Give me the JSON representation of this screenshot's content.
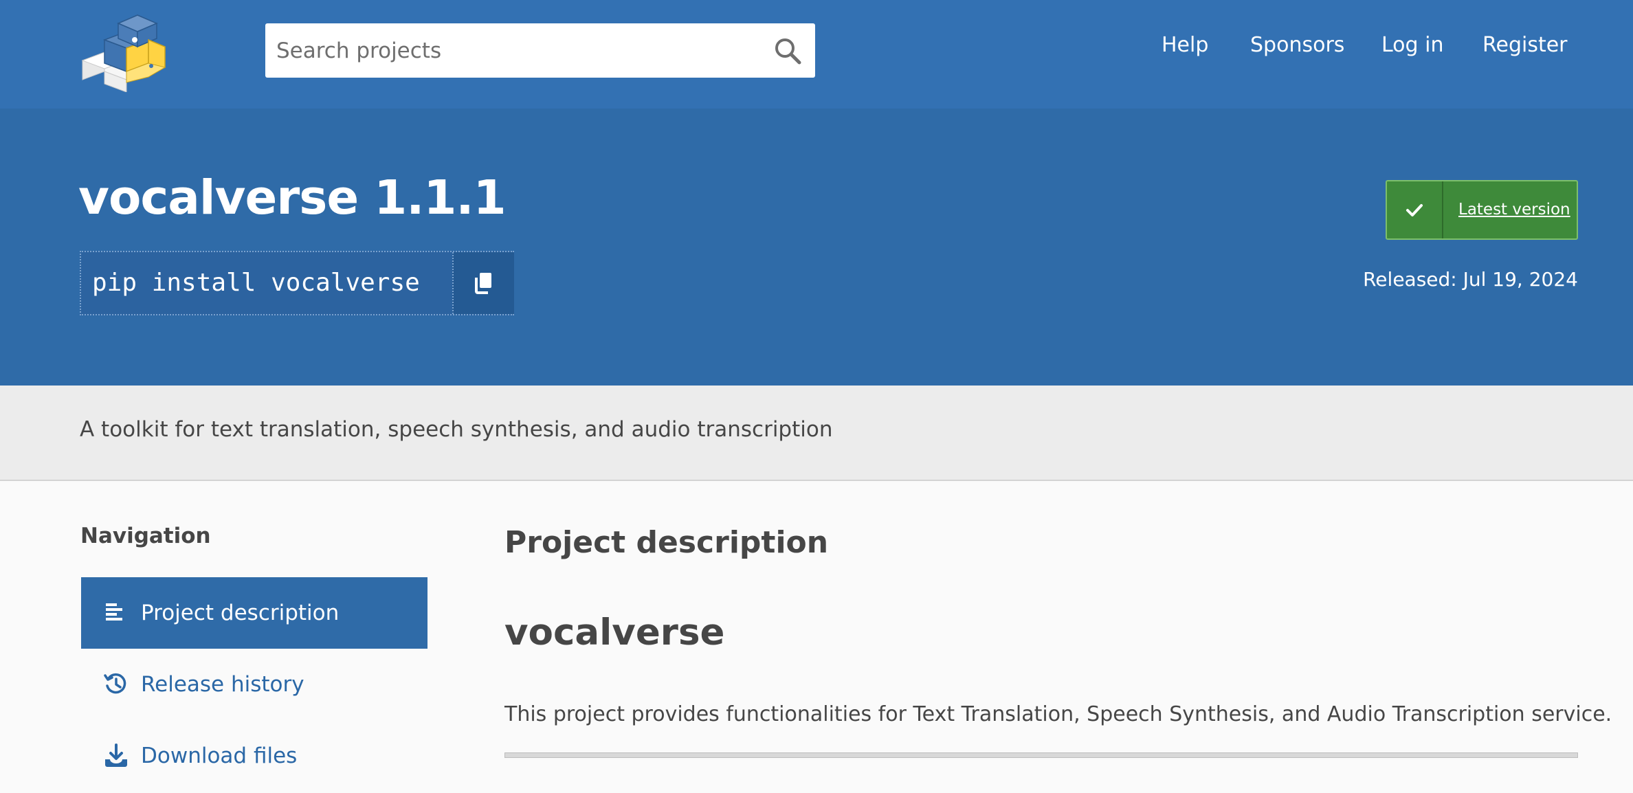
{
  "header": {
    "logo_icon": "pypi-logo-icon",
    "search": {
      "placeholder": "Search projects",
      "value": "",
      "icon": "search-icon"
    },
    "links": [
      {
        "label": "Help"
      },
      {
        "label": "Sponsors"
      },
      {
        "label": "Log in"
      },
      {
        "label": "Register"
      }
    ]
  },
  "package": {
    "title": "vocalverse 1.1.1",
    "install_command": "pip install vocalverse",
    "copy_icon": "copy-icon",
    "latest_label": "Latest version",
    "latest_icon": "check-icon",
    "released": "Released: Jul 19, 2024",
    "summary": "A toolkit for text translation, speech synthesis, and audio transcription"
  },
  "sidebar": {
    "heading": "Navigation",
    "items": [
      {
        "label": "Project description",
        "icon": "align-left-icon",
        "active": true
      },
      {
        "label": "Release history",
        "icon": "history-icon",
        "active": false
      },
      {
        "label": "Download files",
        "icon": "download-icon",
        "active": false
      }
    ]
  },
  "main": {
    "heading": "Project description",
    "readme_title": "vocalverse",
    "readme_text": "This project provides functionalities for Text Translation, Speech Synthesis, and Audio Transcription service."
  },
  "colors": {
    "header_blue": "#3371b3",
    "hero_blue": "#2f6ba8",
    "latest_green": "#3e8a3a",
    "link_blue": "#2a67a6"
  }
}
